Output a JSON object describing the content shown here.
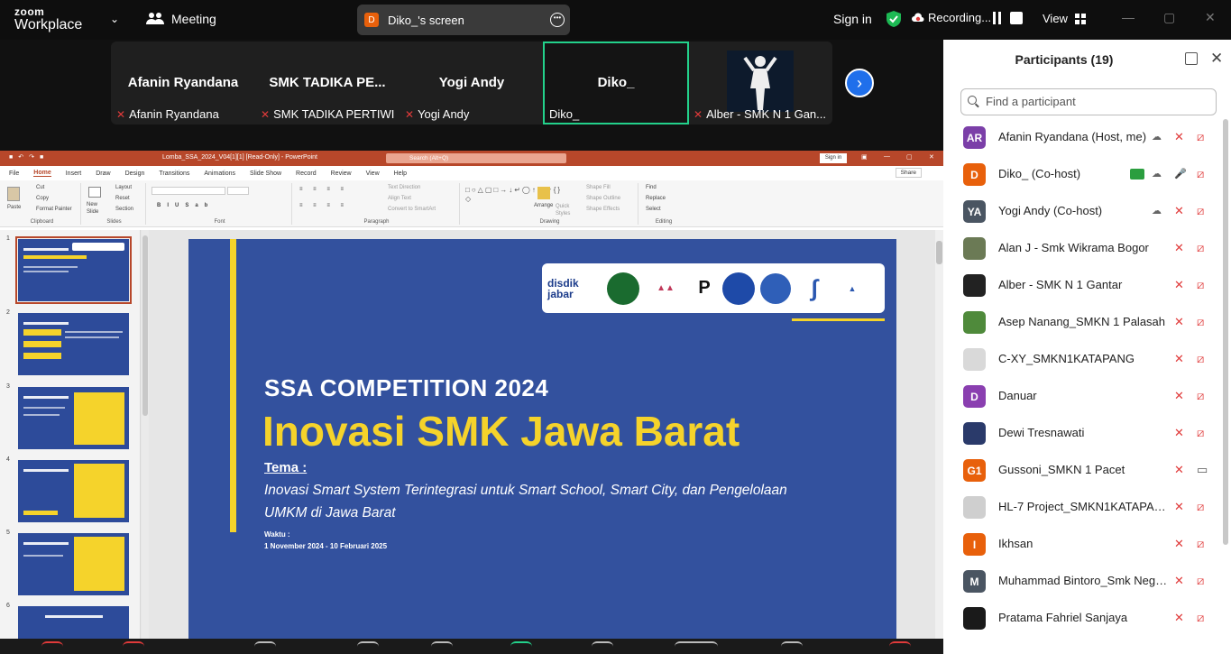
{
  "brand": {
    "line1": "zoom",
    "line2": "Workplace"
  },
  "meeting_label": "Meeting",
  "screen_share": {
    "initial": "D",
    "label": "Diko_'s screen"
  },
  "top_right": {
    "signin": "Sign in",
    "recording": "Recording...",
    "view": "View"
  },
  "video_tiles": [
    {
      "name": "Afanin Ryandana",
      "label": "Afanin Ryandana"
    },
    {
      "name": "SMK TADIKA PE...",
      "label": "SMK TADIKA PERTIWI"
    },
    {
      "name": "Yogi Andy",
      "label": "Yogi Andy"
    },
    {
      "name": "Diko_",
      "label": "Diko_"
    },
    {
      "name": "",
      "label": "Alber - SMK N 1 Gan..."
    }
  ],
  "ppt": {
    "filename": "Lomba_SSA_2024_V04[1][1] [Read-Only] - PowerPoint",
    "search": "Search (Alt+Q)",
    "signin": "Sign in",
    "tabs": [
      "File",
      "Home",
      "Insert",
      "Draw",
      "Design",
      "Transitions",
      "Animations",
      "Slide Show",
      "Record",
      "Review",
      "View",
      "Help"
    ],
    "share": "Share",
    "ribbon": {
      "clipboard": [
        "Paste",
        "Cut",
        "Copy",
        "Format Painter"
      ],
      "clipboard_cap": "Clipboard",
      "slides": [
        "New Slide",
        "Layout",
        "Reset",
        "Section"
      ],
      "slides_cap": "Slides",
      "font_cap": "Font",
      "paragraph": [
        "Text Direction",
        "Align Text",
        "Convert to SmartArt"
      ],
      "paragraph_cap": "Paragraph",
      "drawing": [
        "Arrange",
        "Quick Styles",
        "Shape Fill",
        "Shape Outline",
        "Shape Effects"
      ],
      "drawing_cap": "Drawing",
      "editing": [
        "Find",
        "Replace",
        "Select"
      ],
      "editing_cap": "Editing"
    },
    "thumbnails": [
      "1",
      "2",
      "3",
      "4",
      "5",
      "6"
    ],
    "slide": {
      "logo_text": "disdik jabar",
      "subtitle": "SSA COMPETITION 2024",
      "title": "Inovasi SMK Jawa Barat",
      "tema_label": "Tema :",
      "description": "Inovasi Smart System Terintegrasi untuk Smart School, Smart City, dan Pengelolaan UMKM di Jawa Barat",
      "waktu_label": "Waktu :",
      "dates": "1 November 2024 - 10 Februari 2025"
    }
  },
  "participants": {
    "title": "Participants (19)",
    "search_placeholder": "Find a participant",
    "list": [
      {
        "initials": "AR",
        "name": "Afanin Ryandana (Host, me)",
        "color": "#7b3fa8",
        "mic": "muted",
        "cam": "off",
        "cloud": true,
        "share": false
      },
      {
        "initials": "D",
        "name": "Diko_ (Co-host)",
        "color": "#e8600b",
        "mic": "on",
        "cam": "off",
        "cloud": true,
        "share": true
      },
      {
        "initials": "YA",
        "name": "Yogi Andy (Co-host)",
        "color": "#4a5562",
        "mic": "muted",
        "cam": "off",
        "cloud": true,
        "share": false
      },
      {
        "initials": "",
        "name": "Alan J - Smk Wikrama Bogor",
        "color": "#6b7a55",
        "mic": "muted",
        "cam": "off",
        "cloud": false,
        "share": false
      },
      {
        "initials": "",
        "name": "Alber - SMK N 1 Gantar",
        "color": "#222222",
        "mic": "muted",
        "cam": "off",
        "cloud": false,
        "share": false
      },
      {
        "initials": "",
        "name": "Asep Nanang_SMKN 1 Palasah",
        "color": "#4f8a3b",
        "mic": "muted",
        "cam": "off",
        "cloud": false,
        "share": false
      },
      {
        "initials": "",
        "name": "C-XY_SMKN1KATAPANG",
        "color": "#d9d9d9",
        "mic": "muted",
        "cam": "off",
        "cloud": false,
        "share": false
      },
      {
        "initials": "D",
        "name": "Danuar",
        "color": "#8a3fb0",
        "mic": "muted",
        "cam": "off",
        "cloud": false,
        "share": false
      },
      {
        "initials": "",
        "name": "Dewi Tresnawati",
        "color": "#2a3a6a",
        "mic": "muted",
        "cam": "off",
        "cloud": false,
        "share": false
      },
      {
        "initials": "G1",
        "name": "Gussoni_SMKN 1 Pacet",
        "color": "#e8600b",
        "mic": "muted",
        "cam": "on",
        "cloud": false,
        "share": false
      },
      {
        "initials": "",
        "name": "HL-7 Project_SMKN1KATAPANG",
        "color": "#cfcfcf",
        "mic": "muted",
        "cam": "off",
        "cloud": false,
        "share": false
      },
      {
        "initials": "I",
        "name": "Ikhsan",
        "color": "#e8600b",
        "mic": "muted",
        "cam": "off",
        "cloud": false,
        "share": false
      },
      {
        "initials": "M",
        "name": "Muhammad Bintoro_Smk Negeri...",
        "color": "#4a5562",
        "mic": "muted",
        "cam": "off",
        "cloud": false,
        "share": false
      },
      {
        "initials": "",
        "name": "Pratama Fahriel Sanjaya",
        "color": "#1a1a1a",
        "mic": "muted",
        "cam": "off",
        "cloud": false,
        "share": false
      }
    ]
  }
}
